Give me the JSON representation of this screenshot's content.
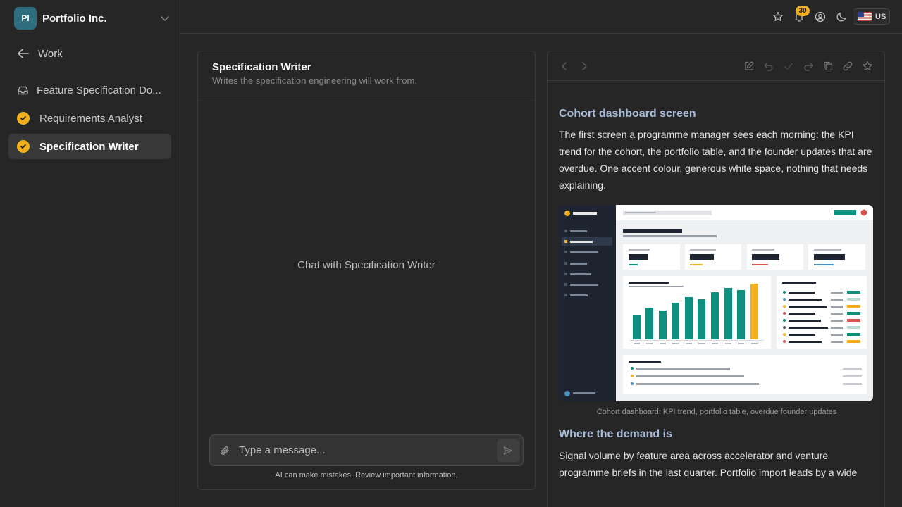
{
  "org": {
    "initials": "PI",
    "name": "Portfolio Inc."
  },
  "sidebar": {
    "back_label": "Work",
    "items": [
      {
        "label": "Feature Specification Do...",
        "icon": "inbox-icon",
        "active": false
      },
      {
        "label": "Requirements Analyst",
        "icon": "check-circle-icon",
        "active": false
      },
      {
        "label": "Specification Writer",
        "icon": "check-circle-icon",
        "active": true
      }
    ]
  },
  "topbar": {
    "notification_count": "30",
    "locale": "US",
    "icons": [
      "star-icon",
      "bell-icon",
      "user-circle-icon",
      "moon-icon",
      "us-flag-icon"
    ]
  },
  "chat": {
    "title": "Specification Writer",
    "subtitle": "Writes the specification engineering will work from.",
    "empty_state": "Chat with Specification Writer",
    "input_placeholder": "Type a message...",
    "disclaimer": "AI can make mistakes. Review important information."
  },
  "document": {
    "toolbar_icons": [
      "chevron-left-icon",
      "chevron-right-icon",
      "edit-icon",
      "undo-icon",
      "check-icon",
      "redo-icon",
      "copy-icon",
      "link-icon",
      "star-icon"
    ],
    "section1_heading": "Cohort dashboard screen",
    "section1_body": "The first screen a programme manager sees each morning: the KPI trend for the cohort, the portfolio table, and the founder updates that are overdue. One accent colour, generous white space, nothing that needs explaining.",
    "figure_caption": "Cohort dashboard: KPI trend, portfolio table, overdue founder updates",
    "section2_heading": "Where the demand is",
    "section2_body": "Signal volume by feature area across accelerator and venture programme briefs in the last quarter. Portfolio import leads by a wide"
  },
  "colors": {
    "background": "#262626",
    "accent": "#f2b01e",
    "teal": "#0f8f7d",
    "heading": "#a9bcd8"
  }
}
